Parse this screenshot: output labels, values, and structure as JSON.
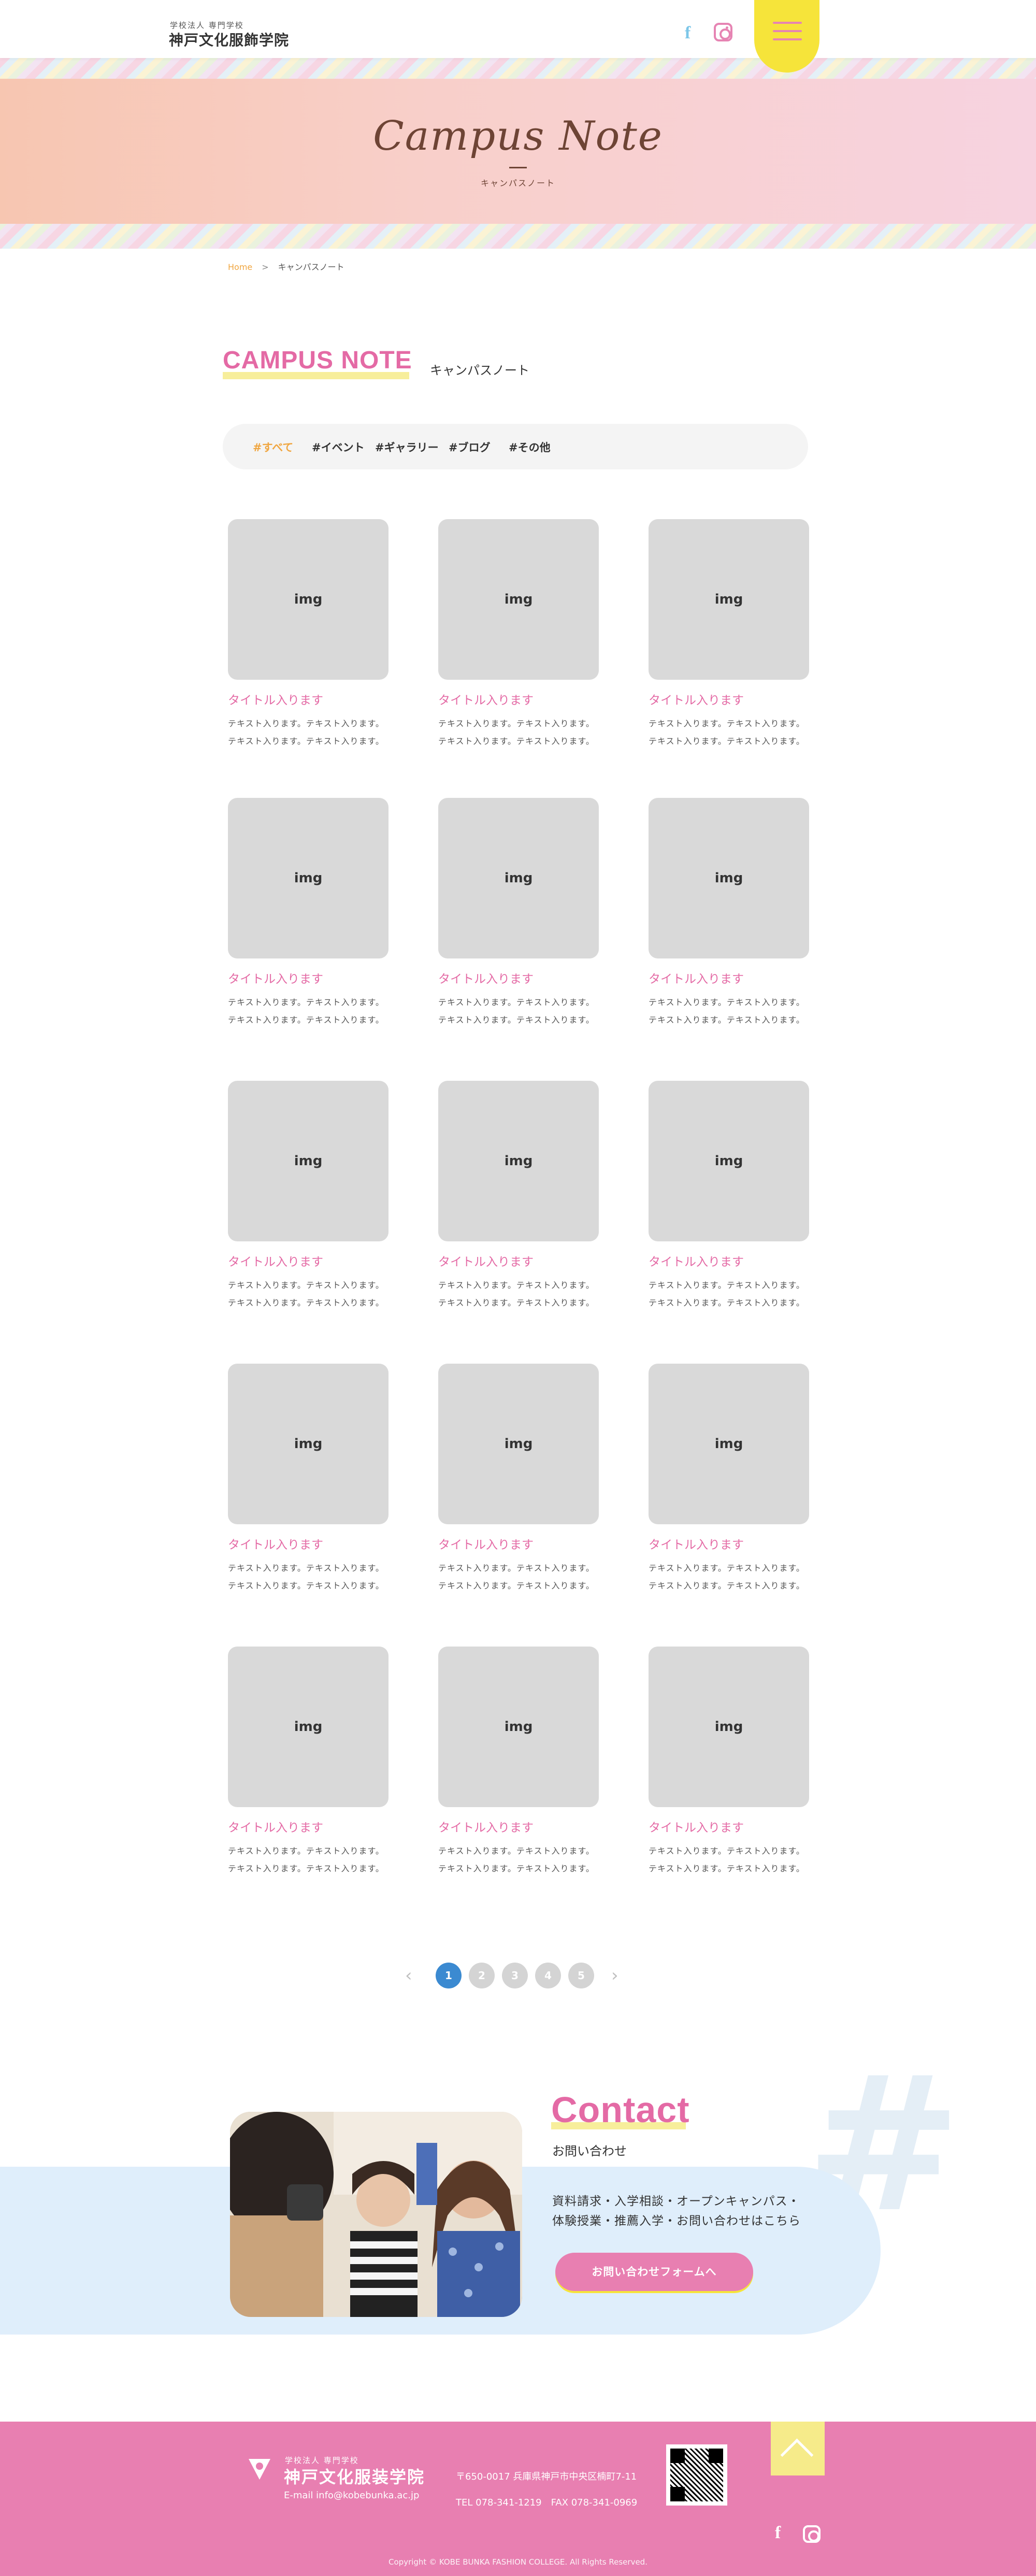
{
  "header": {
    "logo_small": "学校法人 専門学校",
    "logo_main": "神戸文化服飾学院",
    "facebook_icon": "facebook-icon",
    "instagram_icon": "instagram-icon",
    "menu_icon": "hamburger-menu-icon"
  },
  "hero": {
    "title": "Campus Note",
    "subtitle": "キャンパスノート"
  },
  "breadcrumb": {
    "home": "Home",
    "separator": ">",
    "current": "キャンパスノート"
  },
  "section": {
    "title_en": "CAMPUS NOTE",
    "title_ja": "キャンパスノート"
  },
  "filters": [
    {
      "label": "#すべて",
      "active": true
    },
    {
      "label": "#イベント",
      "active": false
    },
    {
      "label": "#ギャラリー",
      "active": false
    },
    {
      "label": "#ブログ",
      "active": false
    },
    {
      "label": "#その他",
      "active": false
    }
  ],
  "cards": [
    {
      "img": "img",
      "title": "タイトル入ります",
      "text": "テキスト入ります。テキスト入ります。テキスト入ります。テキスト入ります。"
    },
    {
      "img": "img",
      "title": "タイトル入ります",
      "text": "テキスト入ります。テキスト入ります。テキスト入ります。テキスト入ります。"
    },
    {
      "img": "img",
      "title": "タイトル入ります",
      "text": "テキスト入ります。テキスト入ります。テキスト入ります。テキスト入ります。"
    },
    {
      "img": "img",
      "title": "タイトル入ります",
      "text": "テキスト入ります。テキスト入ります。テキスト入ります。テキスト入ります。"
    },
    {
      "img": "img",
      "title": "タイトル入ります",
      "text": "テキスト入ります。テキスト入ります。テキスト入ります。テキスト入ります。"
    },
    {
      "img": "img",
      "title": "タイトル入ります",
      "text": "テキスト入ります。テキスト入ります。テキスト入ります。テキスト入ります。"
    },
    {
      "img": "img",
      "title": "タイトル入ります",
      "text": "テキスト入ります。テキスト入ります。テキスト入ります。テキスト入ります。"
    },
    {
      "img": "img",
      "title": "タイトル入ります",
      "text": "テキスト入ります。テキスト入ります。テキスト入ります。テキスト入ります。"
    },
    {
      "img": "img",
      "title": "タイトル入ります",
      "text": "テキスト入ります。テキスト入ります。テキスト入ります。テキスト入ります。"
    },
    {
      "img": "img",
      "title": "タイトル入ります",
      "text": "テキスト入ります。テキスト入ります。テキスト入ります。テキスト入ります。"
    },
    {
      "img": "img",
      "title": "タイトル入ります",
      "text": "テキスト入ります。テキスト入ります。テキスト入ります。テキスト入ります。"
    },
    {
      "img": "img",
      "title": "タイトル入ります",
      "text": "テキスト入ります。テキスト入ります。テキスト入ります。テキスト入ります。"
    },
    {
      "img": "img",
      "title": "タイトル入ります",
      "text": "テキスト入ります。テキスト入ります。テキスト入ります。テキスト入ります。"
    },
    {
      "img": "img",
      "title": "タイトル入ります",
      "text": "テキスト入ります。テキスト入ります。テキスト入ります。テキスト入ります。"
    },
    {
      "img": "img",
      "title": "タイトル入ります",
      "text": "テキスト入ります。テキスト入ります。テキスト入ります。テキスト入ります。"
    }
  ],
  "pagination": {
    "prev_icon": "chevron-left-icon",
    "next_icon": "chevron-right-icon",
    "pages": [
      "1",
      "2",
      "3",
      "4",
      "5"
    ],
    "current": "1"
  },
  "contact": {
    "title": "Contact",
    "subtitle": "お問い合わせ",
    "text": "資料請求・入学相談・オープンキャンパス・体験授業・推薦入学・お問い合わせはこちら",
    "button": "お問い合わせフォームへ"
  },
  "footer": {
    "logo_small": "学校法人 専門学校",
    "logo_main": "神戸文化服装学院",
    "email": "E-mail info@kobebunka.ac.jp",
    "address": "〒650-0017 兵庫県神戸市中央区楠町7-11",
    "tel": "TEL 078-341-1219　FAX 078-341-0969",
    "copyright": "Copyright © KOBE BUNKA FASHION COLLEGE. All Rights Reserved.",
    "page_top_icon": "chevron-up-icon"
  },
  "colors": {
    "pink": "#e46aa5",
    "footer_pink": "#e87fb1",
    "yellow": "#f6e43a",
    "orange": "#f0a640",
    "blue": "#3b8ad1",
    "light_blue": "#dfeefb"
  }
}
